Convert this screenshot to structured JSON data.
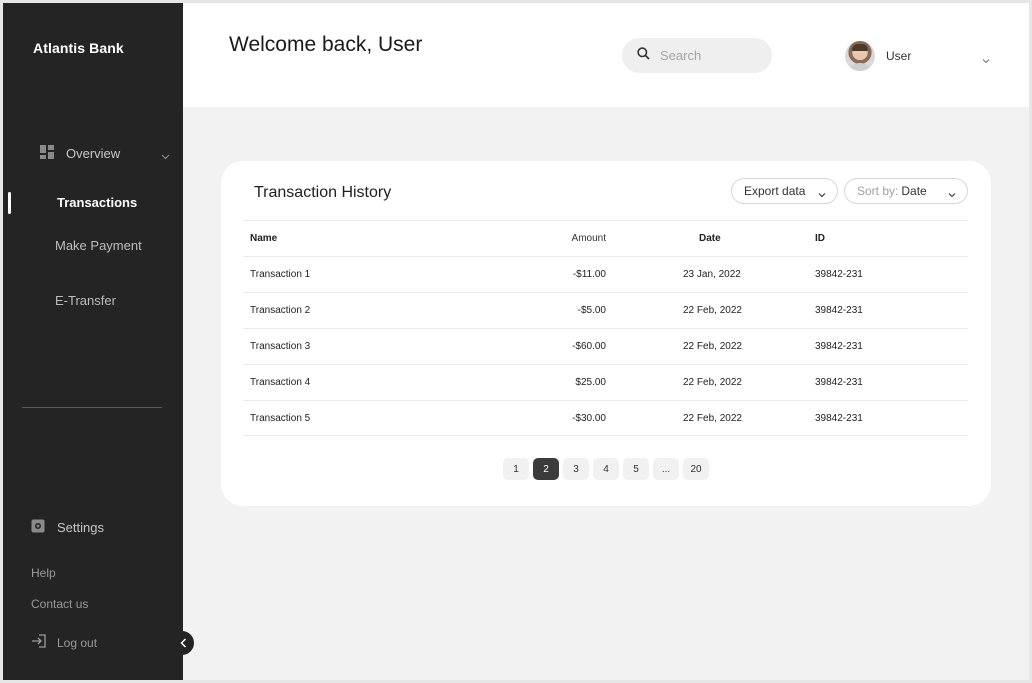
{
  "brand": "Atlantis Bank",
  "sidebar": {
    "overview": "Overview",
    "transactions": "Transactions",
    "make_payment": "Make Payment",
    "etransfer": "E-Transfer",
    "settings": "Settings",
    "help": "Help",
    "contact": "Contact us",
    "logout": "Log out"
  },
  "header": {
    "title": "Welcome back, User",
    "search_placeholder": "Search",
    "user_name": "User"
  },
  "card": {
    "title": "Transaction History",
    "export_label": "Export data",
    "sort_prefix": "Sort by: ",
    "sort_value": "Date"
  },
  "table": {
    "columns": [
      "Name",
      "Amount",
      "Date",
      "ID"
    ],
    "rows": [
      [
        "Transaction 1",
        "-$11.00",
        "23 Jan, 2022",
        "39842-231"
      ],
      [
        "Transaction 2",
        "-$5.00",
        "22 Feb, 2022",
        "39842-231"
      ],
      [
        "Transaction 3",
        "-$60.00",
        "22 Feb, 2022",
        "39842-231"
      ],
      [
        "Transaction 4",
        "$25.00",
        "22 Feb, 2022",
        "39842-231"
      ],
      [
        "Transaction 5",
        "-$30.00",
        "22 Feb, 2022",
        "39842-231"
      ]
    ]
  },
  "pagination": {
    "pages": [
      "1",
      "2",
      "3",
      "4",
      "5",
      "...",
      "20"
    ],
    "active": "2"
  },
  "colors": {
    "sidebar_bg": "#242424",
    "main_bg": "#f2f2f2",
    "active_page": "#3b3b3b"
  }
}
